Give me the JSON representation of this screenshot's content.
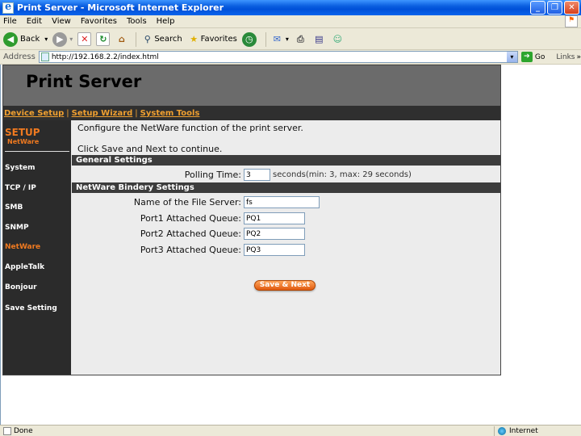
{
  "window": {
    "title": "Print Server - Microsoft Internet Explorer"
  },
  "menu": [
    "File",
    "Edit",
    "View",
    "Favorites",
    "Tools",
    "Help"
  ],
  "toolbar": {
    "back": "Back",
    "search": "Search",
    "favorites": "Favorites"
  },
  "address": {
    "label": "Address",
    "url": "http://192.168.2.2/index.html",
    "go": "Go",
    "links": "Links"
  },
  "page": {
    "title": "Print Server",
    "nav": [
      "Device Setup",
      "Setup Wizard",
      "System Tools"
    ],
    "side": {
      "setup": "SETUP",
      "sub": "NetWare",
      "items": [
        "System",
        "TCP / IP",
        "SMB",
        "SNMP",
        "NetWare",
        "AppleTalk",
        "Bonjour",
        "Save Setting"
      ],
      "active": "NetWare"
    },
    "intro1": "Configure the NetWare function of the print server.",
    "intro2": "Click Save and Next to continue.",
    "general": {
      "heading": "General Settings",
      "polling_label": "Polling Time:",
      "polling_value": "3",
      "polling_suffix": "seconds(min: 3, max: 29 seconds)"
    },
    "bindery": {
      "heading": "NetWare Bindery Settings",
      "file_server_label": "Name of the File Server:",
      "file_server_value": "fs",
      "port1_label": "Port1 Attached Queue:",
      "port1_value": "PQ1",
      "port2_label": "Port2 Attached Queue:",
      "port2_value": "PQ2",
      "port3_label": "Port3 Attached Queue:",
      "port3_value": "PQ3"
    },
    "save_button": "Save & Next"
  },
  "status": {
    "text": "Done",
    "zone": "Internet"
  },
  "colors": {
    "accent": "#f07a20",
    "nav_bg": "#2f2f2f",
    "header_bg": "#6b6b6b"
  }
}
